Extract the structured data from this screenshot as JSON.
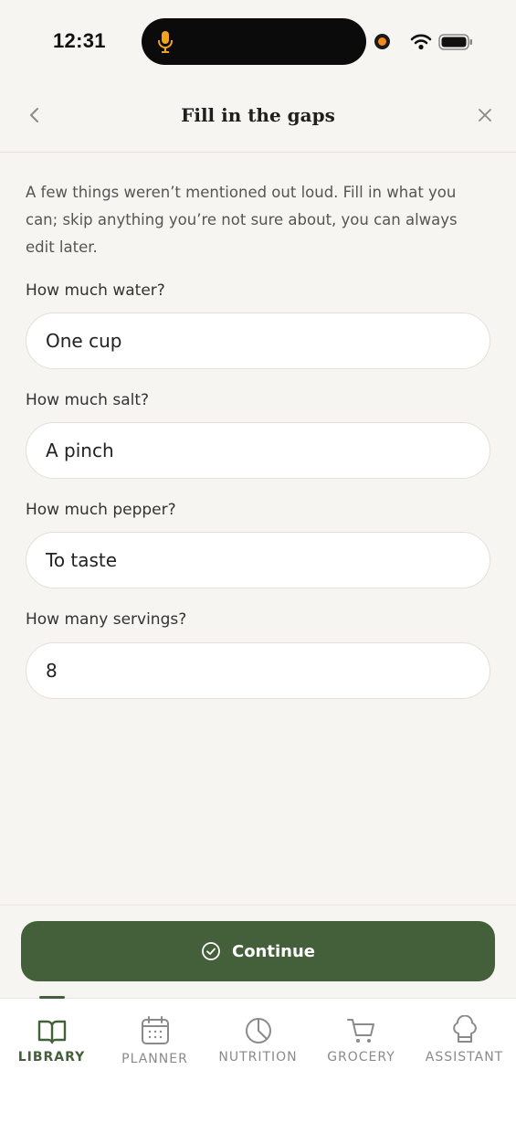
{
  "status_bar": {
    "time": "12:31"
  },
  "header": {
    "title": "Fill in the gaps"
  },
  "intro_text": "A few things weren’t mentioned out loud. Fill in what you can; skip anything you’re not sure about, you can always edit later.",
  "fields": [
    {
      "label": "How much water?",
      "value": "One cup"
    },
    {
      "label": "How much salt?",
      "value": "A pinch"
    },
    {
      "label": "How much pepper?",
      "value": "To taste"
    },
    {
      "label": "How many servings?",
      "value": "8"
    }
  ],
  "continue_label": "Continue",
  "tabs": [
    {
      "label": "LIBRARY",
      "icon": "book-icon",
      "active": true
    },
    {
      "label": "PLANNER",
      "icon": "calendar-icon",
      "active": false
    },
    {
      "label": "NUTRITION",
      "icon": "pie-chart-icon",
      "active": false
    },
    {
      "label": "GROCERY",
      "icon": "cart-icon",
      "active": false
    },
    {
      "label": "ASSISTANT",
      "icon": "chef-hat-icon",
      "active": false
    }
  ],
  "colors": {
    "accent": "#43603b",
    "background": "#f7f5f1",
    "recording": "#f28b1c"
  }
}
